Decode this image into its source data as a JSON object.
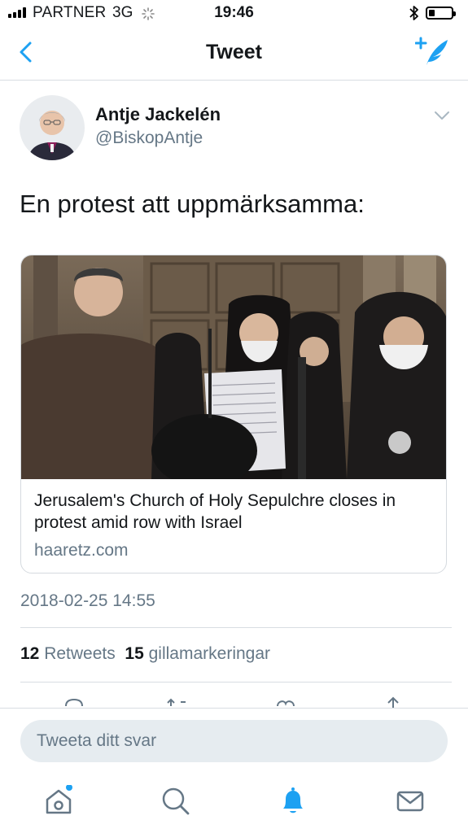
{
  "status_bar": {
    "carrier": "PARTNER",
    "network": "3G",
    "time": "19:46",
    "battery_level": 0.25
  },
  "nav": {
    "title": "Tweet",
    "back_icon": "chevron-left-icon",
    "compose_icon": "compose-tweet-icon"
  },
  "tweet": {
    "author_name": "Antje Jackelén",
    "author_handle": "@BiskopAntje",
    "text": "En protest att uppmärksamma:",
    "timestamp": "2018-02-25 14:55"
  },
  "card": {
    "title": "Jerusalem's Church of Holy Sepulchre closes in protest amid row with Israel",
    "domain": "haaretz.com"
  },
  "stats": {
    "retweets_count": "12",
    "retweets_label": "Retweets",
    "likes_count": "15",
    "likes_label": "gillamarkeringar"
  },
  "reply": {
    "placeholder": "Tweeta ditt svar"
  },
  "tab_bar": {
    "items": [
      "home-icon",
      "search-icon",
      "notifications-icon",
      "messages-icon"
    ]
  },
  "colors": {
    "accent": "#1da1f2",
    "secondary_text": "#657786",
    "primary_text": "#14171a",
    "divider": "#d8dde2"
  }
}
